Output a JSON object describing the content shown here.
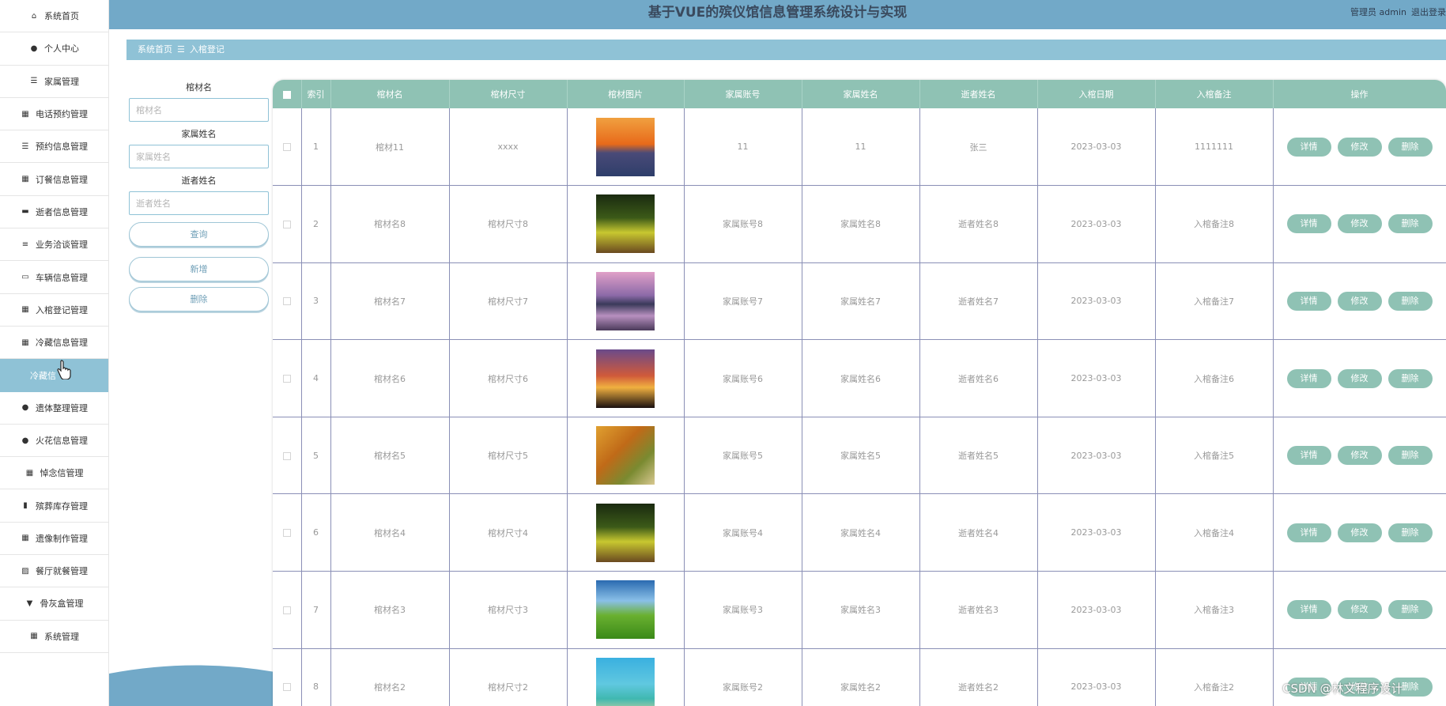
{
  "app": {
    "title": "基于VUE的殡仪馆信息管理系统设计与实现"
  },
  "header": {
    "user_label": "管理员 admin",
    "logout_label": "退出登录"
  },
  "sidebar": {
    "items": [
      {
        "label": "系统首页",
        "icon": "home-icon"
      },
      {
        "label": "个人中心",
        "icon": "person-icon"
      },
      {
        "label": "家属管理",
        "icon": "list-icon"
      },
      {
        "label": "电话预约管理",
        "icon": "grid-icon"
      },
      {
        "label": "预约信息管理",
        "icon": "list-icon"
      },
      {
        "label": "订餐信息管理",
        "icon": "grid-icon"
      },
      {
        "label": "逝者信息管理",
        "icon": "printer-icon"
      },
      {
        "label": "业务洽谈管理",
        "icon": "sliders-icon"
      },
      {
        "label": "车辆信息管理",
        "icon": "monitor-icon"
      },
      {
        "label": "入棺登记管理",
        "icon": "grid-icon"
      },
      {
        "label": "冷藏信息管理",
        "icon": "grid-icon"
      },
      {
        "label": "冷藏信",
        "icon": "",
        "active": true
      },
      {
        "label": "遗体整理管理",
        "icon": "person-icon"
      },
      {
        "label": "火花信息管理",
        "icon": "person-icon"
      },
      {
        "label": "悼念信管理",
        "icon": "grid-icon"
      },
      {
        "label": "殡葬库存管理",
        "icon": "clipboard-icon"
      },
      {
        "label": "遗像制作管理",
        "icon": "grid-icon"
      },
      {
        "label": "餐厅就餐管理",
        "icon": "chart-icon"
      },
      {
        "label": "骨灰盒管理",
        "icon": "cup-icon"
      },
      {
        "label": "系统管理",
        "icon": "grid-icon"
      }
    ]
  },
  "breadcrumb": {
    "home": "系统首页",
    "separator": "☰",
    "current": "入棺登记"
  },
  "search": {
    "fields": [
      {
        "label": "棺材名",
        "placeholder": "棺材名",
        "value": ""
      },
      {
        "label": "家属姓名",
        "placeholder": "家属姓名",
        "value": ""
      },
      {
        "label": "逝者姓名",
        "placeholder": "逝者姓名",
        "value": ""
      }
    ],
    "query_label": "查询",
    "add_label": "新增",
    "delete_label": "删除"
  },
  "table": {
    "columns": [
      "索引",
      "棺材名",
      "棺材尺寸",
      "棺材图片",
      "家属账号",
      "家属姓名",
      "逝者姓名",
      "入棺日期",
      "入棺备注",
      "操作"
    ],
    "row_actions": {
      "detail": "详情",
      "edit": "修改",
      "delete": "删除"
    },
    "rows": [
      {
        "index": "1",
        "name": "棺材11",
        "size": "xxxx",
        "image": "sunset-river",
        "account": "11",
        "family": "11",
        "deceased": "张三",
        "date": "2023-03-03",
        "note": "1111111"
      },
      {
        "index": "2",
        "name": "棺材名8",
        "size": "棺材尺寸8",
        "image": "tree-avenue",
        "account": "家属账号8",
        "family": "家属姓名8",
        "deceased": "逝者姓名8",
        "date": "2023-03-03",
        "note": "入棺备注8"
      },
      {
        "index": "3",
        "name": "棺材名7",
        "size": "棺材尺寸7",
        "image": "mountain-lake",
        "account": "家属账号7",
        "family": "家属姓名7",
        "deceased": "逝者姓名7",
        "date": "2023-03-03",
        "note": "入棺备注7"
      },
      {
        "index": "4",
        "name": "棺材名6",
        "size": "棺材尺寸6",
        "image": "sunset-sky",
        "account": "家属账号6",
        "family": "家属姓名6",
        "deceased": "逝者姓名6",
        "date": "2023-03-03",
        "note": "入棺备注6"
      },
      {
        "index": "5",
        "name": "棺材名5",
        "size": "棺材尺寸5",
        "image": "autumn-path",
        "account": "家属账号5",
        "family": "家属姓名5",
        "deceased": "逝者姓名5",
        "date": "2023-03-03",
        "note": "入棺备注5"
      },
      {
        "index": "6",
        "name": "棺材名4",
        "size": "棺材尺寸4",
        "image": "tree-avenue",
        "account": "家属账号4",
        "family": "家属姓名4",
        "deceased": "逝者姓名4",
        "date": "2023-03-03",
        "note": "入棺备注4"
      },
      {
        "index": "7",
        "name": "棺材名3",
        "size": "棺材尺寸3",
        "image": "green-field",
        "account": "家属账号3",
        "family": "家属姓名3",
        "deceased": "逝者姓名3",
        "date": "2023-03-03",
        "note": "入棺备注3"
      },
      {
        "index": "8",
        "name": "棺材名2",
        "size": "棺材尺寸2",
        "image": "tropical-beach",
        "account": "家属账号2",
        "family": "家属姓名2",
        "deceased": "逝者姓名2",
        "date": "2023-03-03",
        "note": "入棺备注2"
      }
    ]
  },
  "watermark": "CSDN @林文程序设计",
  "colors": {
    "header": "#72a9c8",
    "accent": "#8fc2d6",
    "table_header": "#8fc2b4",
    "row_border": "#8a8fb6"
  }
}
